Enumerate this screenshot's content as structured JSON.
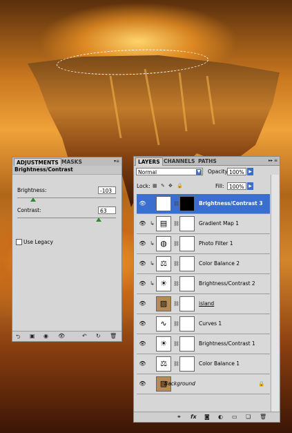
{
  "adjustments": {
    "tabs": [
      {
        "label": "ADJUSTMENTS"
      },
      {
        "label": "MASKS"
      }
    ],
    "title": "Brightness/Contrast",
    "brightness": {
      "label": "Brightness:",
      "value": "-103"
    },
    "contrast": {
      "label": "Contrast:",
      "value": "63"
    },
    "legacy": {
      "label": "Use Legacy",
      "checked": false
    },
    "footer_icons": [
      "back-arrow-icon",
      "view-icon",
      "clip-icon",
      "eye-icon",
      "previous-state-icon",
      "reset-icon",
      "trash-icon"
    ]
  },
  "layers_panel": {
    "tabs": [
      {
        "label": "LAYERS"
      },
      {
        "label": "CHANNELS"
      },
      {
        "label": "PATHS"
      }
    ],
    "blend_mode": "Normal",
    "opacity_label": "Opacity:",
    "opacity": "100%",
    "lock_label": "Lock:",
    "fill_label": "Fill:",
    "fill": "100%",
    "layers": [
      {
        "name": "Brightness/Contrast 3",
        "icon": "sun-icon",
        "selected": true,
        "clipped": false,
        "bold": true,
        "italic": false
      },
      {
        "name": "Gradient Map 1",
        "icon": "gradient-icon",
        "selected": false,
        "clipped": true,
        "bold": false,
        "italic": false
      },
      {
        "name": "Photo Filter 1",
        "icon": "camera-icon",
        "selected": false,
        "clipped": true,
        "bold": false,
        "italic": false
      },
      {
        "name": "Color Balance 2",
        "icon": "scale-icon",
        "selected": false,
        "clipped": true,
        "bold": false,
        "italic": false
      },
      {
        "name": "Brightness/Contrast 2",
        "icon": "sun-icon",
        "selected": false,
        "clipped": true,
        "bold": false,
        "italic": false
      },
      {
        "name": "island",
        "icon": "image-icon",
        "selected": false,
        "clipped": false,
        "bold": false,
        "italic": false
      },
      {
        "name": "Curves 1",
        "icon": "curves-icon",
        "selected": false,
        "clipped": false,
        "bold": false,
        "italic": false
      },
      {
        "name": "Brightness/Contrast 1",
        "icon": "sun-icon",
        "selected": false,
        "clipped": false,
        "bold": false,
        "italic": false
      },
      {
        "name": "Color Balance 1",
        "icon": "scale-icon",
        "selected": false,
        "clipped": false,
        "bold": false,
        "italic": false
      },
      {
        "name": "Background",
        "icon": "image-icon",
        "selected": false,
        "clipped": false,
        "bold": false,
        "italic": true
      }
    ]
  }
}
